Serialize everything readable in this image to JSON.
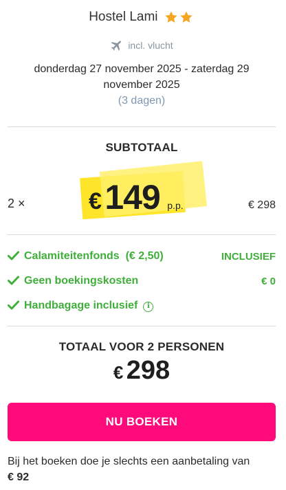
{
  "hotel": {
    "name": "Hostel Lami",
    "stars": 2,
    "star_icon": "star-icon",
    "star_color": "#f5a623"
  },
  "trip": {
    "flight_icon": "airplane-icon",
    "flight_label": "incl. vlucht",
    "dates": "donderdag 27 november 2025 - zaterdag 29 november 2025",
    "nights": "(3 dagen)"
  },
  "subtotal": {
    "label": "SUBTOTAAL",
    "quantity": "2 ×",
    "currency": "€",
    "price": "149",
    "per_person": "p.p.",
    "line_total": "€ 298",
    "highlight_color": "#ffe52a"
  },
  "features": [
    {
      "icon": "check-icon",
      "label": "Calamiteitenfonds  (€ 2,50)",
      "value": "INCLUSIEF"
    },
    {
      "icon": "check-icon",
      "label": "Geen boekingskosten",
      "value": "€ 0"
    },
    {
      "icon": "check-icon",
      "label": "Handbagage inclusief",
      "value": "",
      "info_icon": "info-icon",
      "info_symbol": "i"
    }
  ],
  "total": {
    "label": "TOTAAL VOOR 2 PERSONEN",
    "currency": "€",
    "amount": "298"
  },
  "book_button": {
    "label": "NU BOEKEN",
    "color": "#ff0a7a"
  },
  "deposit": {
    "text": "Bij het boeken doe je slechts een aanbetaling van",
    "amount": "€ 92"
  },
  "colors": {
    "accent_green": "#3fae3a",
    "muted_blue": "#7f98b2"
  }
}
